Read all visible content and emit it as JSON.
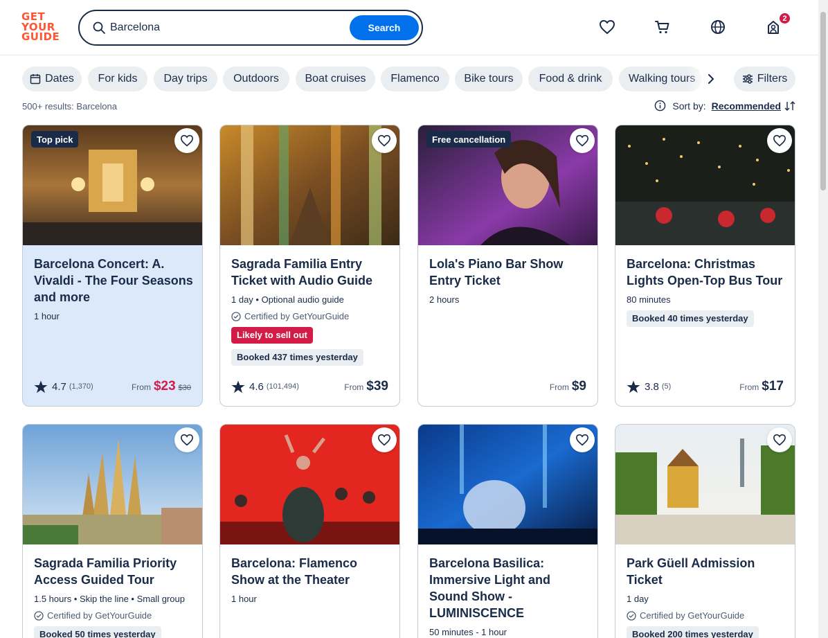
{
  "header": {
    "logo_lines": [
      "GET",
      "YOUR",
      "GUIDE"
    ],
    "search_value": "Barcelona",
    "search_button": "Search",
    "cart_badge": "2",
    "icons": [
      "heart-icon",
      "cart-icon",
      "globe-icon",
      "account-icon"
    ]
  },
  "filters": {
    "chips": [
      {
        "label": "Dates",
        "icon": "calendar-icon"
      },
      {
        "label": "For kids"
      },
      {
        "label": "Day trips"
      },
      {
        "label": "Outdoors"
      },
      {
        "label": "Boat cruises"
      },
      {
        "label": "Flamenco"
      },
      {
        "label": "Bike tours"
      },
      {
        "label": "Food & drink"
      },
      {
        "label": "Walking tours"
      }
    ],
    "filters_button": "Filters"
  },
  "results": {
    "count": "500+ results:",
    "query": "Barcelona",
    "sort_label": "Sort by:",
    "sort_value": "Recommended"
  },
  "cards": [
    {
      "tag": "Top pick",
      "title": "Barcelona Concert: A. Vivaldi - The Four Seasons and more",
      "meta": "1 hour",
      "rating": "4.7",
      "reviews": "(1,370)",
      "from": "From",
      "price": "$23",
      "old_price": "$30"
    },
    {
      "title": "Sagrada Familia Entry Ticket with Audio Guide",
      "meta": "1 day • Optional audio guide",
      "certified": "Certified by GetYourGuide",
      "alert": "Likely to sell out",
      "booked": "Booked 437 times yesterday",
      "rating": "4.6",
      "reviews": "(101,494)",
      "from": "From",
      "price": "$39"
    },
    {
      "tag": "Free cancellation",
      "title": "Lola's Piano Bar Show Entry Ticket",
      "meta": "2 hours",
      "from": "From",
      "price": "$9"
    },
    {
      "title": "Barcelona: Christmas Lights Open-Top Bus Tour",
      "meta": "80 minutes",
      "booked": "Booked 40 times yesterday",
      "rating": "3.8",
      "reviews": "(5)",
      "from": "From",
      "price": "$17"
    },
    {
      "title": "Sagrada Familia Priority Access Guided Tour",
      "meta": "1.5 hours • Skip the line • Small group",
      "certified": "Certified by GetYourGuide",
      "booked": "Booked 50 times yesterday"
    },
    {
      "title": "Barcelona: Flamenco Show at the Theater",
      "meta": "1 hour"
    },
    {
      "title": "Barcelona Basilica: Immersive Light and Sound Show - LUMINISCENCE",
      "meta": "50 minutes - 1 hour"
    },
    {
      "title": "Park Güell Admission Ticket",
      "meta": "1 day",
      "certified": "Certified by GetYourGuide",
      "booked": "Booked 200 times yesterday"
    }
  ],
  "colors": {
    "brand": "#ff5533",
    "primary": "#0071eb",
    "text": "#1a2b49",
    "alert": "#d21c47",
    "highlight": "#dbe9fb"
  }
}
